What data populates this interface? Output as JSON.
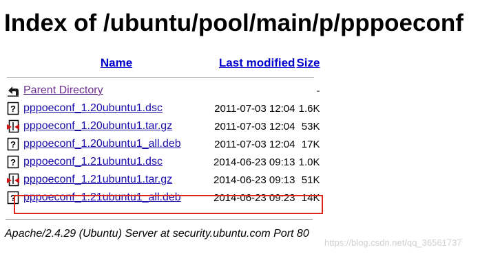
{
  "page": {
    "title": "Index of /ubuntu/pool/main/p/pppoeconf"
  },
  "columns": {
    "name": "Name",
    "last_modified": "Last modified",
    "size": "Size"
  },
  "parent": {
    "label": "Parent Directory",
    "size": "-",
    "icon": "back-arrow-icon"
  },
  "files": [
    {
      "name": "pppoeconf_1.20ubuntu1.dsc",
      "modified": "2011-07-03 12:04",
      "size": "1.6K",
      "icon": "text-file-icon"
    },
    {
      "name": "pppoeconf_1.20ubuntu1.tar.gz",
      "modified": "2011-07-03 12:04",
      "size": "53K",
      "icon": "archive-file-icon"
    },
    {
      "name": "pppoeconf_1.20ubuntu1_all.deb",
      "modified": "2011-07-03 12:04",
      "size": "17K",
      "icon": "unknown-file-icon"
    },
    {
      "name": "pppoeconf_1.21ubuntu1.dsc",
      "modified": "2014-06-23 09:13",
      "size": "1.0K",
      "icon": "text-file-icon"
    },
    {
      "name": "pppoeconf_1.21ubuntu1.tar.gz",
      "modified": "2014-06-23 09:13",
      "size": "51K",
      "icon": "archive-file-icon"
    },
    {
      "name": "pppoeconf_1.21ubuntu1_all.deb",
      "modified": "2014-06-23 09:23",
      "size": "14K",
      "icon": "unknown-file-icon"
    }
  ],
  "footer": {
    "address": "Apache/2.4.29 (Ubuntu) Server at security.ubuntu.com Port 80"
  },
  "watermark": "https://blog.csdn.net/qq_36561737",
  "colors": {
    "link": "#1a0dab",
    "visited": "#6b2f8f",
    "highlight_border": "#e0231b"
  }
}
